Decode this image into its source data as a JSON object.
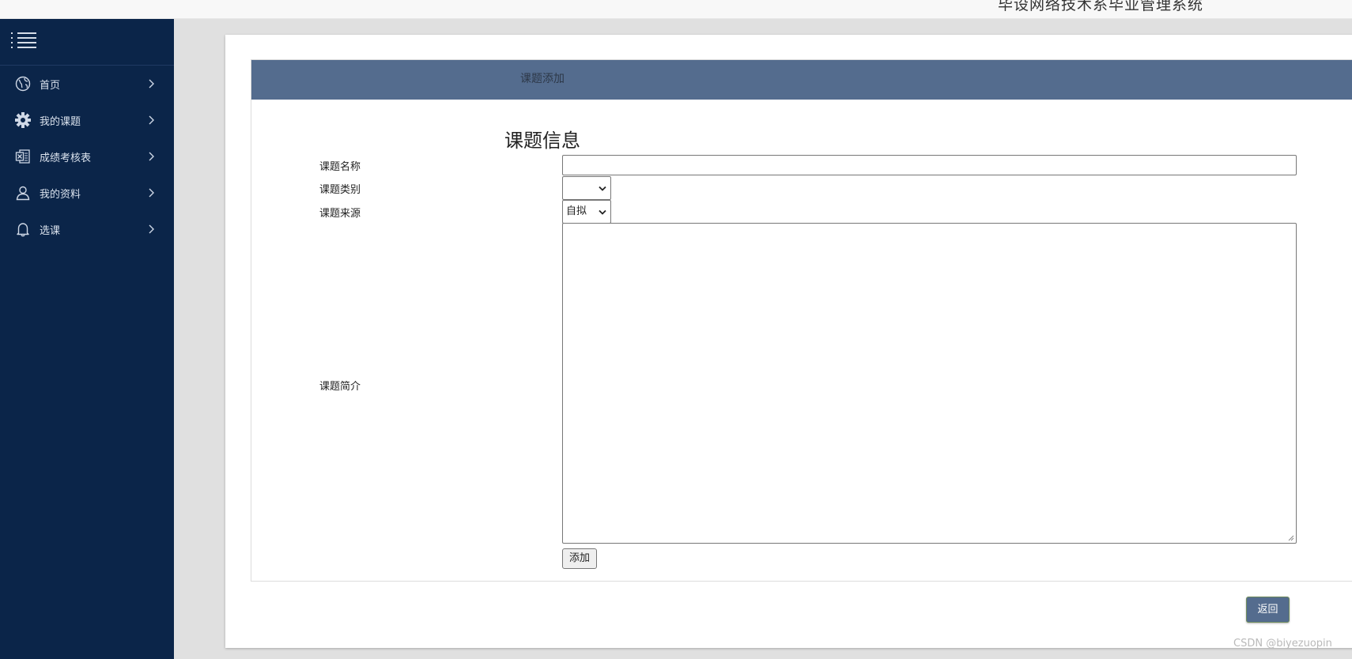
{
  "header": {
    "system_title": "毕设网络技术系毕业管理系统"
  },
  "sidebar": {
    "items": [
      {
        "label": "首页",
        "icon": "globe-icon"
      },
      {
        "label": "我的课题",
        "icon": "gear-icon"
      },
      {
        "label": "成绩考核表",
        "icon": "excel-file-icon"
      },
      {
        "label": "我的资料",
        "icon": "user-icon"
      },
      {
        "label": "选课",
        "icon": "bell-icon"
      }
    ]
  },
  "panel": {
    "header": "课题添加"
  },
  "form": {
    "title": "课题信息",
    "name_label": "课题名称",
    "name_value": "",
    "category_label": "课题类别",
    "category_value": "",
    "source_label": "课题来源",
    "source_value": "自拟",
    "intro_label": "课题简介",
    "intro_value": "",
    "add_label": "添加"
  },
  "actions": {
    "return_label": "返回"
  },
  "watermark": "CSDN @biyezuopin",
  "colors": {
    "sidebar_bg": "#0b2549",
    "panel_header_bg": "#546c8e",
    "page_bg": "#e0e0e0"
  }
}
